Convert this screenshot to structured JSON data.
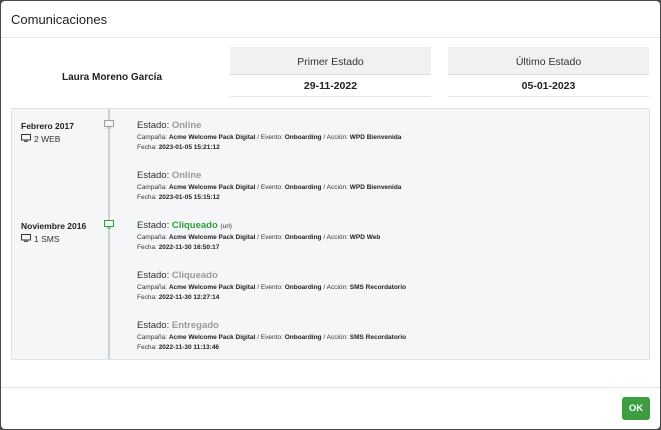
{
  "modal": {
    "title": "Comunicaciones"
  },
  "summary": {
    "person": "Laura Moreno García",
    "first_state_label": "Primer Estado",
    "first_state_date": "29-11-2022",
    "last_state_label": "Último Estado",
    "last_state_date": "05-01-2023"
  },
  "labels": {
    "estado": "Estado:",
    "campana": "Campaña:",
    "evento": "Evento:",
    "accion": "Acción:",
    "fecha": "Fecha:",
    "sep": "/"
  },
  "groups": [
    {
      "title": "Febrero 2017",
      "count": "2 WEB",
      "icon": "monitor-icon",
      "color": "#9aa0a6"
    },
    {
      "title": "Noviembre 2016",
      "count": "1 SMS",
      "icon": "monitor-icon",
      "color": "#2e9e3a"
    }
  ],
  "entries": [
    {
      "status": "Online",
      "extra": "",
      "campaign": "Acme Welcome Pack Digital",
      "event": "Onboarding",
      "action": "WPD Bienvenida",
      "date": "2023-01-05 15:21:12"
    },
    {
      "status": "Online",
      "extra": "",
      "campaign": "Acme Welcome Pack Digital",
      "event": "Onboarding",
      "action": "WPD Bienvenida",
      "date": "2023-01-05 15:15:12"
    },
    {
      "status": "Cliqueado",
      "extra": "(url)",
      "campaign": "Acme Welcome Pack Digital",
      "event": "Onboarding",
      "action": "WPD Web",
      "date": "2022-11-30 16:50:17"
    },
    {
      "status": "Cliqueado",
      "extra": "",
      "campaign": "Acme Welcome Pack Digital",
      "event": "Onboarding",
      "action": "SMS Recordatorio",
      "date": "2022-11-30 12:27:14"
    },
    {
      "status": "Entregado",
      "extra": "",
      "campaign": "Acme Welcome Pack Digital",
      "event": "Onboarding",
      "action": "SMS Recordatorio",
      "date": "2022-11-30 11:13:46"
    }
  ],
  "colors": {
    "status_gray": "#9a9a9a",
    "status_green": "#2e9e3a",
    "ok_button": "#3c9e40"
  },
  "footer": {
    "ok_label": "OK"
  }
}
